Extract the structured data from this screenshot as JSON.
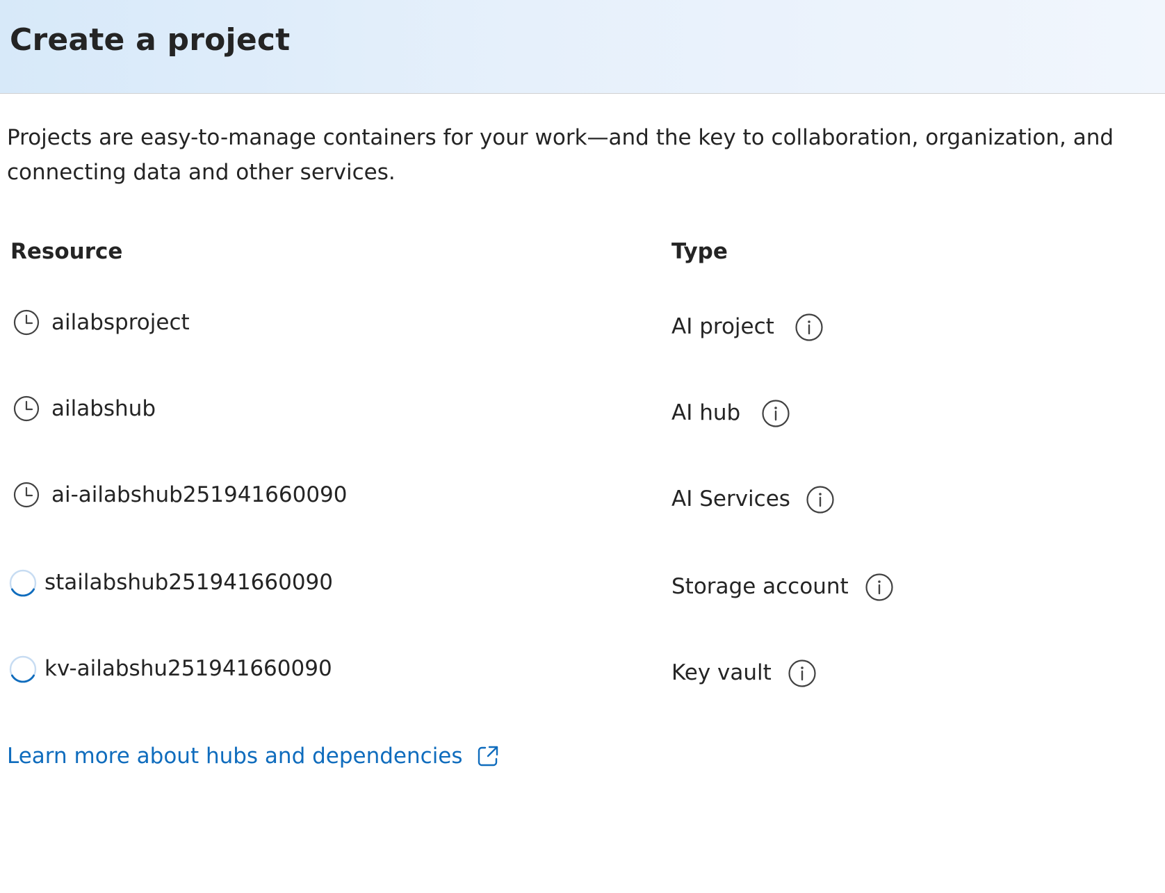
{
  "header": {
    "title": "Create a project"
  },
  "description": "Projects are easy-to-manage containers for your work—and the key to collaboration, organization, and connecting data and other services.",
  "table": {
    "columns": [
      "Resource",
      "Type"
    ],
    "rows": [
      {
        "resource": "ailabsproject",
        "type": "AI project",
        "status": "pending",
        "status_icon": "clock-icon"
      },
      {
        "resource": "ailabshub",
        "type": "AI hub",
        "status": "pending",
        "status_icon": "clock-icon"
      },
      {
        "resource": "ai-ailabshub251941660090",
        "type": "AI Services",
        "status": "pending",
        "status_icon": "clock-icon"
      },
      {
        "resource": "stailabshub251941660090",
        "type": "Storage account",
        "status": "in-progress",
        "status_icon": "spinner-icon"
      },
      {
        "resource": "kv-ailabshu251941660090",
        "type": "Key vault",
        "status": "in-progress",
        "status_icon": "spinner-icon"
      }
    ]
  },
  "link": {
    "label": "Learn more about hubs and dependencies",
    "icon": "external-link-icon"
  },
  "colors": {
    "header_gradient_start": "#d7e9f9",
    "header_gradient_end": "#f1f6fd",
    "text": "#242424",
    "link": "#0f6cbd",
    "spinner": "#0f6cbd",
    "icon_gray": "#424242"
  }
}
